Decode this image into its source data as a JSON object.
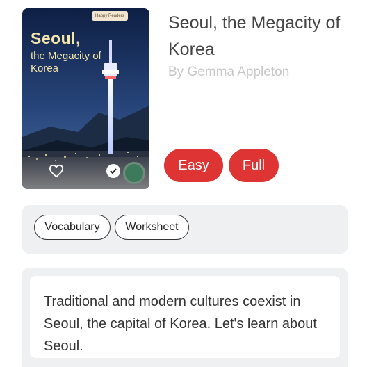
{
  "book": {
    "title": "Seoul, the Megacity of Korea",
    "author": "By Gemma Appleton"
  },
  "cover": {
    "brand": "Happy Readers",
    "title": "Seoul,",
    "subtitle": "the Megacity of Korea",
    "status_color": "#3d7a5c"
  },
  "levels": [
    "Easy",
    "Full"
  ],
  "tags": [
    "Vocabulary",
    "Worksheet"
  ],
  "description": "Traditional and modern cultures coexist in Seoul, the capital of Korea. Let's learn about Seoul.",
  "colors": {
    "accent": "#df3434",
    "panel": "#eff0f2",
    "author_text": "#c7c7c7"
  }
}
